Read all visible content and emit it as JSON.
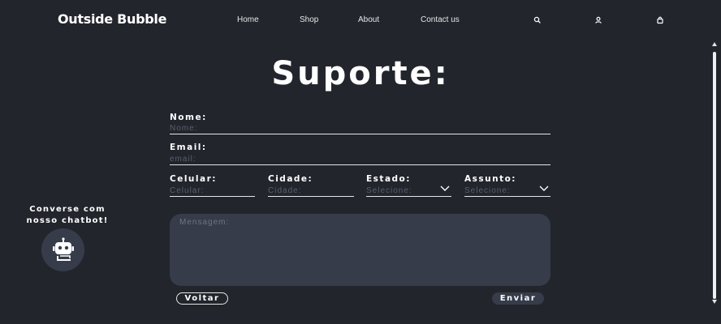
{
  "navbar": {
    "brand": "Outside Bubble",
    "links": [
      "Home",
      "Shop",
      "About",
      "Contact us"
    ],
    "icons": [
      "search-icon",
      "user-icon",
      "bag-icon"
    ]
  },
  "page": {
    "title": "Suporte:"
  },
  "form": {
    "nome": {
      "label": "Nome:",
      "placeholder": "Nome:",
      "value": ""
    },
    "email": {
      "label": "Email:",
      "placeholder": "email:",
      "value": ""
    },
    "celular": {
      "label": "Celular:",
      "placeholder": "Celular:",
      "value": ""
    },
    "cidade": {
      "label": "Cidade:",
      "placeholder": "Cidade:",
      "value": ""
    },
    "estado": {
      "label": "Estado:",
      "selected": "Selecione:"
    },
    "assunto": {
      "label": "Assunto:",
      "selected": "Selecione:"
    },
    "mensagem": {
      "placeholder": "Mensagem:",
      "value": ""
    },
    "voltar_label": "Voltar",
    "enviar_label": "Enviar"
  },
  "chatbot": {
    "line1": "Converse com",
    "line2": "nosso chatbot!",
    "icon": "robot-icon"
  },
  "colors": {
    "background": "#22252c",
    "surface": "#363c4a",
    "text": "#ffffff",
    "placeholder": "#5b5f69"
  }
}
